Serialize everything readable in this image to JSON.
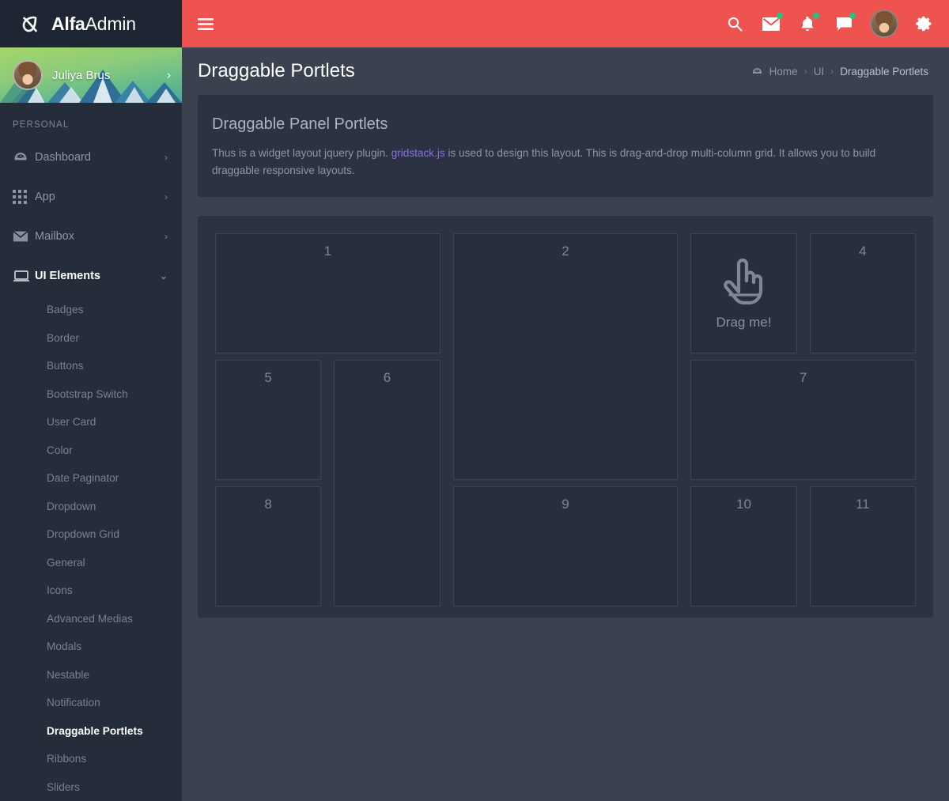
{
  "brand": {
    "logo_icon": "alpha-logo-icon",
    "name_bold": "Alfa",
    "name_light": "Admin"
  },
  "sidebar": {
    "user": {
      "name": "Juliya Brus",
      "avatar_icon": "user-avatar",
      "expand_icon": "chevron-right-icon"
    },
    "section_label": "PERSONAL",
    "nav": [
      {
        "label": "Dashboard",
        "icon": "dashboard-icon",
        "arrow": "chevron-right-icon"
      },
      {
        "label": "App",
        "icon": "grid-apps-icon",
        "arrow": "chevron-right-icon"
      },
      {
        "label": "Mailbox",
        "icon": "envelope-icon",
        "arrow": "chevron-right-icon"
      },
      {
        "label": "UI Elements",
        "icon": "laptop-icon",
        "arrow": "chevron-down-icon",
        "expanded": true
      }
    ],
    "ui_elements_children": [
      {
        "label": "Badges"
      },
      {
        "label": "Border"
      },
      {
        "label": "Buttons"
      },
      {
        "label": "Bootstrap Switch"
      },
      {
        "label": "User Card"
      },
      {
        "label": "Color"
      },
      {
        "label": "Date Paginator"
      },
      {
        "label": "Dropdown"
      },
      {
        "label": "Dropdown Grid"
      },
      {
        "label": "General"
      },
      {
        "label": "Icons"
      },
      {
        "label": "Advanced Medias"
      },
      {
        "label": "Modals"
      },
      {
        "label": "Nestable"
      },
      {
        "label": "Notification"
      },
      {
        "label": "Draggable Portlets",
        "active": true
      },
      {
        "label": "Ribbons"
      },
      {
        "label": "Sliders"
      }
    ]
  },
  "topbar": {
    "menu_toggle_icon": "hamburger-icon",
    "icons": [
      {
        "name": "search-icon",
        "badge": false
      },
      {
        "name": "mail-icon",
        "badge": true
      },
      {
        "name": "bell-icon",
        "badge": true
      },
      {
        "name": "chat-icon",
        "badge": true
      }
    ],
    "avatar_icon": "user-avatar",
    "settings_icon": "gear-icon",
    "accent_color": "#ef5350",
    "badge_color": "#26c281"
  },
  "page": {
    "title": "Draggable Portlets",
    "breadcrumb": {
      "home_icon": "dashboard-icon",
      "items": [
        "Home",
        "UI",
        "Draggable Portlets"
      ],
      "separator": "›"
    }
  },
  "intro": {
    "title": "Draggable Panel Portlets",
    "text_before": "Thus is a widget layout jquery plugin. ",
    "link_text": "gridstack.js",
    "link_color": "#8b6ee8",
    "text_after": " is used to design this layout. This is drag-and-drop multi-column grid. It allows you to build draggable responsive layouts."
  },
  "portlets": [
    {
      "label": "1",
      "col_start": 1,
      "col_span": 4,
      "row_start": 1,
      "row_span": 2
    },
    {
      "label": "2",
      "col_start": 5,
      "col_span": 4,
      "row_start": 1,
      "row_span": 4
    },
    {
      "label": "Drag me!",
      "icon": "pointing-hand-icon",
      "is_drag_handle": true,
      "col_start": 9,
      "col_span": 2,
      "row_start": 1,
      "row_span": 2
    },
    {
      "label": "4",
      "col_start": 11,
      "col_span": 2,
      "row_start": 1,
      "row_span": 2
    },
    {
      "label": "5",
      "col_start": 1,
      "col_span": 2,
      "row_start": 3,
      "row_span": 2
    },
    {
      "label": "6",
      "col_start": 3,
      "col_span": 2,
      "row_start": 3,
      "row_span": 4
    },
    {
      "label": "7",
      "col_start": 9,
      "col_span": 4,
      "row_start": 3,
      "row_span": 2
    },
    {
      "label": "8",
      "col_start": 1,
      "col_span": 2,
      "row_start": 5,
      "row_span": 2
    },
    {
      "label": "9",
      "col_start": 5,
      "col_span": 4,
      "row_start": 5,
      "row_span": 2
    },
    {
      "label": "10",
      "col_start": 9,
      "col_span": 2,
      "row_start": 5,
      "row_span": 2
    },
    {
      "label": "11",
      "col_start": 11,
      "col_span": 2,
      "row_start": 5,
      "row_span": 2
    }
  ]
}
